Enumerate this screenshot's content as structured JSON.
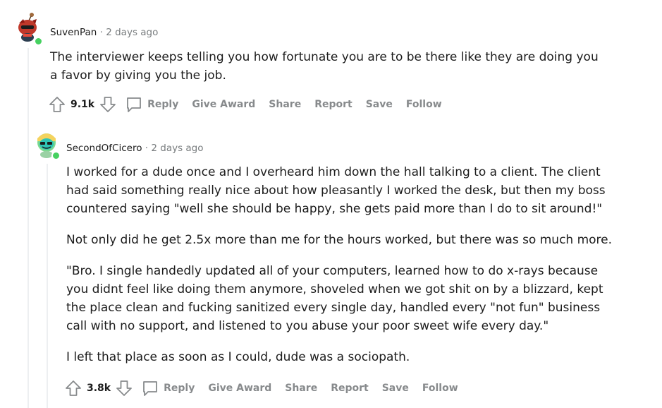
{
  "comments": [
    {
      "author": "SuvenPan",
      "separator": "·",
      "time": "2 days ago",
      "paragraphs": [
        "The interviewer keeps telling you how fortunate you are to be there like they are doing you a favor by giving you the job."
      ],
      "score": "9.1k",
      "actions": {
        "reply": "Reply",
        "give_award": "Give Award",
        "share": "Share",
        "report": "Report",
        "save": "Save",
        "follow": "Follow"
      }
    },
    {
      "author": "SecondOfCicero",
      "separator": "·",
      "time": "2 days ago",
      "paragraphs": [
        "I worked for a dude once and I overheard him down the hall talking to a client. The client had said something really nice about how pleasantly I worked the desk, but then my boss countered saying \"well she should be happy, she gets paid more than I do to sit around!\"",
        "Not only did he get 2.5x more than me for the hours worked, but there was so much more.",
        "\"Bro. I single handedly updated all of your computers, learned how to do x-rays because you didnt feel like doing them anymore, shoveled when we got shit on by a blizzard, kept the place clean and fucking sanitized every single day, handled every \"not fun\" business call with no support, and listened to you abuse your poor sweet wife every day.\"",
        "I left that place as soon as I could, dude was a sociopath."
      ],
      "score": "3.8k",
      "actions": {
        "reply": "Reply",
        "give_award": "Give Award",
        "share": "Share",
        "report": "Report",
        "save": "Save",
        "follow": "Follow"
      }
    }
  ],
  "colors": {
    "thread_line": "#edeff1",
    "muted_text": "#787c7e",
    "action_text": "#878a8c",
    "online_dot": "#46d160"
  },
  "icons": {
    "upvote": "arrow-up-icon",
    "downvote": "arrow-down-icon",
    "reply": "speech-bubble-icon"
  }
}
